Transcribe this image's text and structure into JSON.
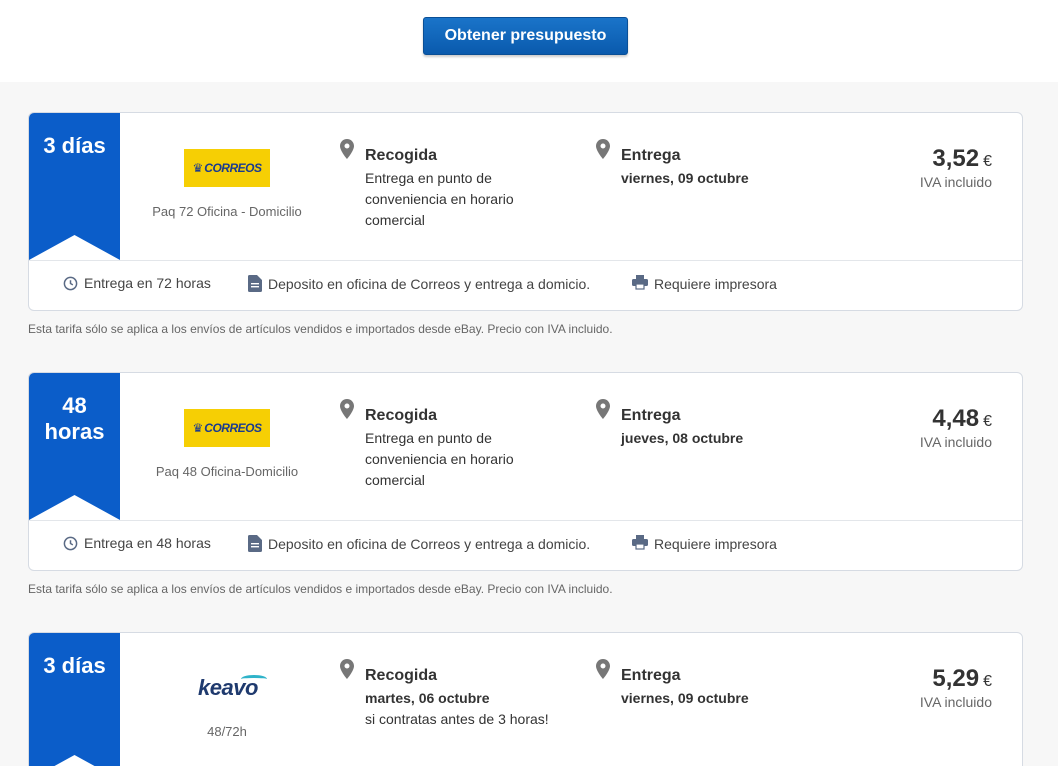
{
  "header": {
    "cta_label": "Obtener presupuesto"
  },
  "colors": {
    "accent": "#0b5dc9",
    "correos_yellow": "#f6cf04",
    "keavo_cyan": "#2fb3c9"
  },
  "labels": {
    "pickup_title": "Recogida",
    "delivery_title": "Entrega",
    "price_note": "IVA incluido",
    "currency": "€"
  },
  "note_text": "Esta tarifa sólo se aplica a los envíos de artículos vendidos e importados desde eBay. Precio con IVA incluido.",
  "offers": [
    {
      "badge_line1": "3 días",
      "badge_line2": "",
      "logo": "CORREOS",
      "service": "Paq 72 Oficina - Domicilio",
      "pickup_line1": "Entrega en punto de",
      "pickup_line2": "conveniencia en horario",
      "pickup_line3": "comercial",
      "delivery_date": "viernes, 09 octubre",
      "price": "3,52",
      "features": [
        "Entrega en 72 horas",
        "Deposito en oficina de Correos y entrega a domicio.",
        "Requiere impresora"
      ]
    },
    {
      "badge_line1": "48",
      "badge_line2": "horas",
      "logo": "CORREOS",
      "service": "Paq 48 Oficina-Domicilio",
      "pickup_line1": "Entrega en punto de",
      "pickup_line2": "conveniencia en horario",
      "pickup_line3": "comercial",
      "delivery_date": "jueves, 08 octubre",
      "price": "4,48",
      "features": [
        "Entrega en 48 horas",
        "Deposito en oficina de Correos y entrega a domicio.",
        "Requiere impresora"
      ]
    },
    {
      "badge_line1": "3 días",
      "badge_line2": "",
      "logo": "keavo",
      "service": "48/72h",
      "pickup_line1": "martes, 06 octubre",
      "pickup_line2": "si contratas antes de 3 horas!",
      "pickup_line3": "",
      "delivery_date": "viernes, 09 octubre",
      "price": "5,29",
      "features": []
    }
  ]
}
